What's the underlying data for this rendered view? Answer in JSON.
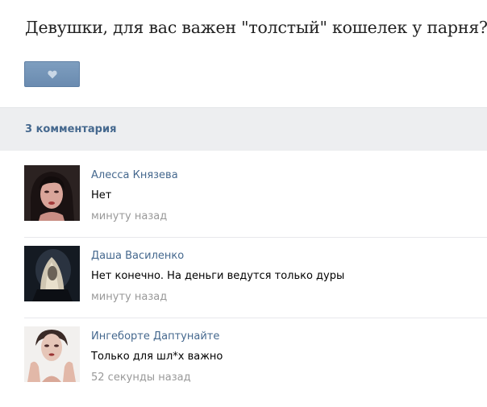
{
  "post": {
    "title": "Девушки, для вас важен \"толстый\" кошелек у парня?",
    "like_icon": "heart-icon",
    "like_color": "#6f90b5"
  },
  "comments_section": {
    "count_label": "3 комментария",
    "link_color": "#45688e",
    "items": [
      {
        "author": "Алесса Князева",
        "text": "Нет",
        "time": "минуту назад",
        "avatar": "avatar-photo"
      },
      {
        "author": "Даша Василенко",
        "text": "Нет конечно. На деньги ведутся только дуры",
        "time": "минуту назад",
        "avatar": "avatar-photo"
      },
      {
        "author": "Ингеборте Даптунайте",
        "text": "Только для шл*х важно",
        "time": "52 секунды назад",
        "avatar": "avatar-photo"
      }
    ]
  }
}
